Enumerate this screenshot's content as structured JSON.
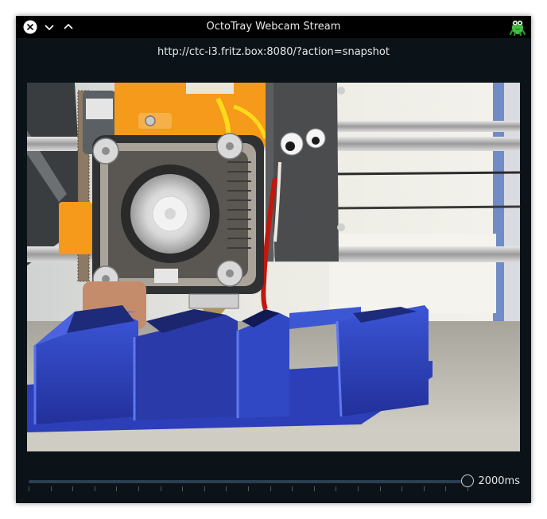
{
  "window": {
    "title": "OctoTray Webcam Stream"
  },
  "stream": {
    "url": "http://ctc-i3.fritz.box:8080/?action=snapshot"
  },
  "refresh_slider": {
    "value": "2000ms",
    "fraction": 1.0,
    "tick_count": 21
  },
  "colors": {
    "window_bg": "#0b1319",
    "titlebar_bg": "#000000",
    "slider_track": "#2b3f50",
    "print_blue": "#2c3fb8",
    "hotend_orange": "#f59a1a"
  },
  "icons": {
    "close": "close-icon",
    "minimize": "chevron-down-icon",
    "maximize": "chevron-up-icon",
    "app": "octotray-icon"
  }
}
